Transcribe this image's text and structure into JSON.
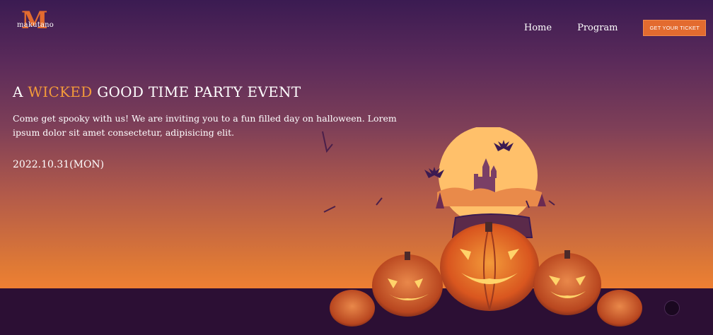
{
  "brand": {
    "logo_letter": "M",
    "logo_text": "makutano"
  },
  "nav": {
    "items": [
      {
        "label": "Home"
      },
      {
        "label": "Program"
      }
    ],
    "cta_label": "GET YOUR TICKET"
  },
  "hero": {
    "headline_prefix": "A ",
    "headline_accent": "WICKED",
    "headline_suffix": " GOOD TIME PARTY EVENT",
    "description": "Come get spooky with us! We are inviting you to a fun filled day on halloween. Lorem ipsum dolor sit amet consectetur, adipisicing elit.",
    "date": "2022.10.31(MON)"
  },
  "colors": {
    "accent": "#e36b2f",
    "headline_accent": "#f39a3a",
    "ground": "#2c0f34"
  },
  "icons": {
    "illustration": "halloween-pumpkins-castle-moon-illustration",
    "scroll": "circle-dot-icon"
  }
}
